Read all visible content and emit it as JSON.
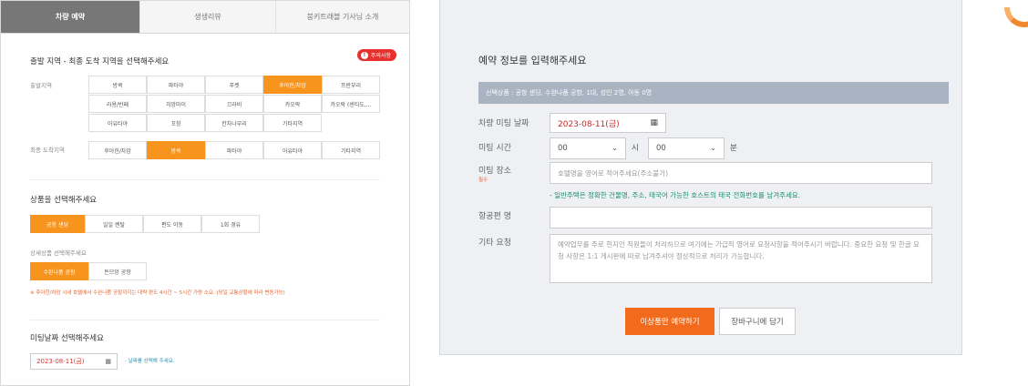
{
  "left": {
    "tabs": [
      "차량 예약",
      "생생리뷰",
      "붕키트래블 기사님 소개"
    ],
    "required_badge": "주의사항",
    "section1_title": "출발 지역 - 최종 도착 지역을 선택해주세요",
    "departure_label": "출발지역",
    "departure_options": [
      [
        "방콕",
        "파타야",
        "푸켓",
        "후아힌/차암",
        "프란부리"
      ],
      [
        "라용/반페",
        "치앙마이",
        "끄라비",
        "카오락",
        "카오락 (센티도,..."
      ],
      [
        "아유타야",
        "꼬창",
        "칸차나부리",
        "기타지역"
      ]
    ],
    "departure_selected": "후아힌/차암",
    "arrival_label": "최종 도착지역",
    "arrival_options": [
      "후아힌/차암",
      "방콕",
      "파타야",
      "아유타야",
      "기타지역"
    ],
    "arrival_selected": "방콕",
    "section2_title": "상품을 선택해주세요",
    "product_options": [
      "공항 샌딩",
      "일일 렌탈",
      "편도 이동",
      "1회 경유"
    ],
    "product_selected": "공항 샌딩",
    "detail_label": "상세상품 선택해주세요",
    "detail_options": [
      "수완나품 공항",
      "돈므앙 공항"
    ],
    "detail_selected": "수완나품 공항",
    "note": "※ 후아힌/차암 시내 호텔에서 수완나품 공항까지는 대략 편도 4시간 ~ 5시간 가량 소요. (당일 교통상황에 따라 변동가능)",
    "section3_title": "미팅날짜 선택해주세요",
    "date_value": "2023-08-11(금)",
    "date_hint": "- 날짜를 선택해 주세요."
  },
  "right": {
    "title": "예약 정보를 입력해주세요",
    "summary": "선택상품 : 공항 샌딩, 수완나품 공항, 1대, 성인 2명, 아동 0명",
    "meeting_date_label": "차량 미팅 날짜",
    "meeting_date_value": "2023-08-11(금)",
    "meeting_time_label": "미팅 시간",
    "hour_value": "00",
    "hour_unit": "시",
    "minute_value": "00",
    "minute_unit": "분",
    "meeting_place_label": "미팅 장소",
    "meeting_place_required": "필수",
    "meeting_place_placeholder": "호텔명을 영어로 적어주세요(주소불가)",
    "meeting_place_note": "- 일반주택은 정확한 건물명, 주소, 태국어 가능한 호스트의 태국 전화번호를 남겨주세요.",
    "flight_label": "항공편 명",
    "flight_value": "",
    "other_label": "기타 요청",
    "other_placeholder": "예약업무를 주로 현지인 직원들이 처리하므로 여기에는 가급적 영어로 요청사항을 적어주시기 바랍니다. 중요한 요청 및 한글 요청 사항은 1:1 게시판에 따로 남겨주셔야 정상적으로 처리가 가능합니다.",
    "book_button": "이상품만 예약하기",
    "cart_button": "장바구니에 담기"
  },
  "icons": {
    "calendar": "calendar-icon",
    "chevron": "chevron-down-icon"
  },
  "colors": {
    "accent_orange": "#f7941d",
    "book_button": "#f26b1d",
    "summary_bar": "#a9b3c1",
    "required_red": "#e8312f"
  }
}
